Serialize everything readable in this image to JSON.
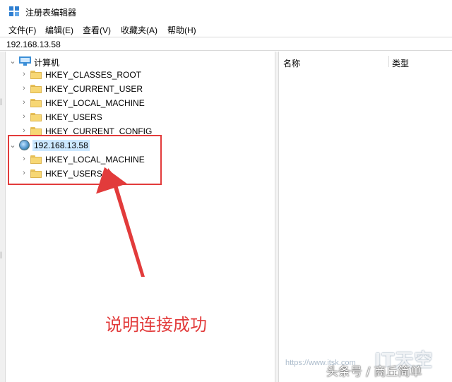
{
  "window": {
    "title": "注册表编辑器"
  },
  "menu": {
    "file": "文件(F)",
    "edit": "编辑(E)",
    "view": "查看(V)",
    "favorites": "收藏夹(A)",
    "help": "帮助(H)"
  },
  "address": {
    "path": "192.168.13.58"
  },
  "tree": {
    "local_root": "计算机",
    "local_hives": [
      "HKEY_CLASSES_ROOT",
      "HKEY_CURRENT_USER",
      "HKEY_LOCAL_MACHINE",
      "HKEY_USERS",
      "HKEY_CURRENT_CONFIG"
    ],
    "remote_root": "192.168.13.58",
    "remote_hives": [
      "HKEY_LOCAL_MACHINE",
      "HKEY_USERS"
    ]
  },
  "list": {
    "columns": [
      "名称",
      "类型"
    ]
  },
  "annotation": {
    "text": "说明连接成功",
    "color": "#e23b3b"
  },
  "watermark": {
    "brand": "IT天空",
    "url": "https://www.itsk.com",
    "source": "头条号 / 商丘简单"
  },
  "colors": {
    "folder": "#f7d774",
    "selection": "#cce8ff",
    "accent": "#3c8fd7"
  }
}
